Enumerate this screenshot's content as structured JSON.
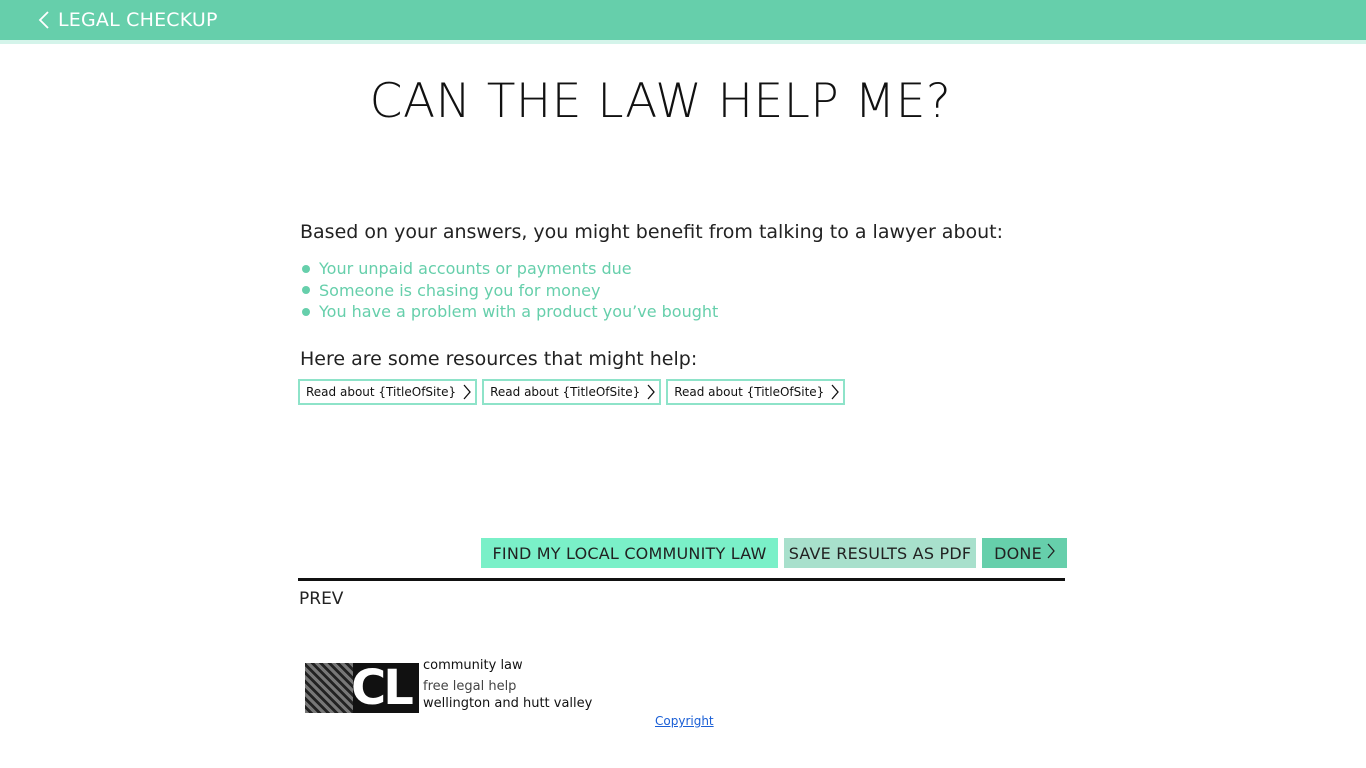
{
  "header": {
    "back_label": "LEGAL CHECKUP",
    "back_icon": "chevron-left-icon",
    "bar_color": "#66cfab"
  },
  "main": {
    "title": "CAN THE LAW HELP ME?",
    "intro": "Based on your answers, you  might benefit from talking to a lawyer about:",
    "topics": [
      "Your unpaid accounts or payments due",
      "Someone is chasing you for money",
      "You have a problem with a product you’ve bought"
    ],
    "topic_color": "#66cfab",
    "resources_heading": "Here are some resources that might help:",
    "resources": [
      "Read about {TitleOfSite}",
      "Read about {TitleOfSite}",
      "Read about {TitleOfSite}"
    ]
  },
  "actions": {
    "find_label": "FIND MY LOCAL COMMUNITY LAW",
    "save_label": "SAVE RESULTS AS PDF",
    "done_label": "DONE",
    "find_color": "#7af0c8",
    "save_color": "#a8e0cc",
    "done_color": "#66cfab"
  },
  "nav": {
    "prev_label": "PREV"
  },
  "footer": {
    "logo_letters": "CL",
    "logo_line1": "community law",
    "logo_line2": "free legal help",
    "logo_line3": "wellington and hutt valley",
    "copyright_label": "Copyright"
  }
}
